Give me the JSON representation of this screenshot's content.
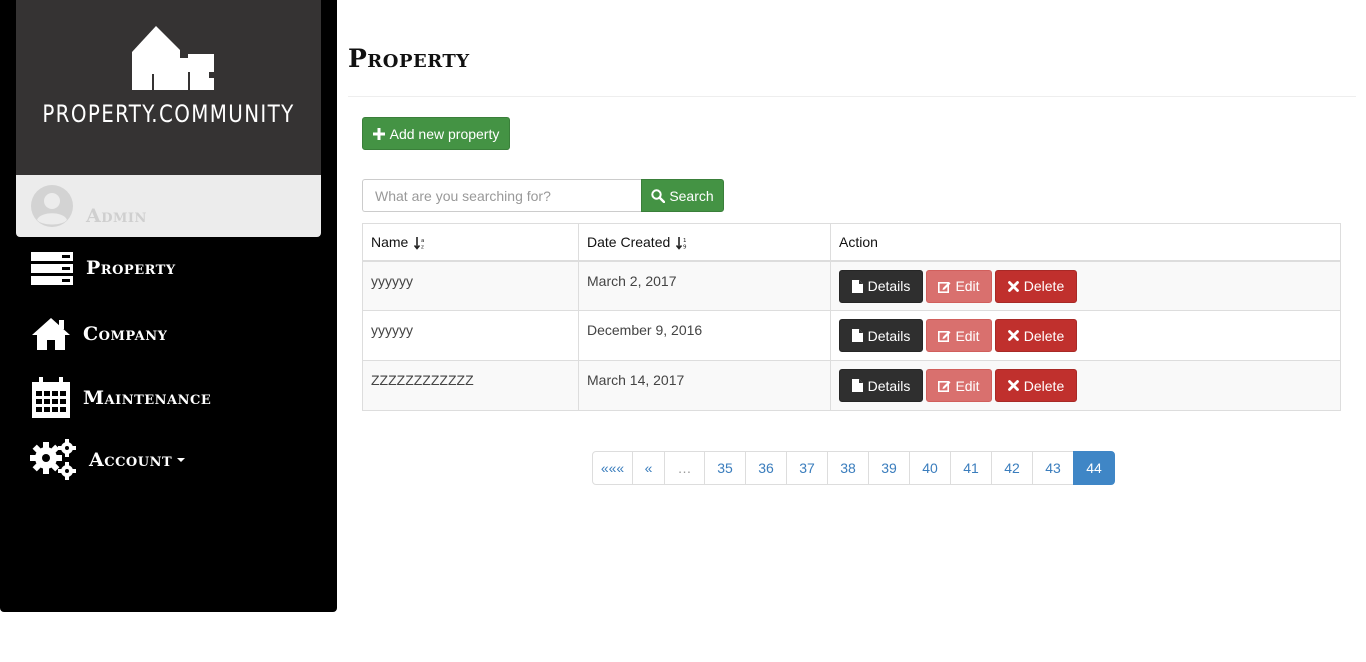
{
  "brand": {
    "name": "PROPERTY.COMMUNITY"
  },
  "user": {
    "name": "Admin"
  },
  "nav": [
    {
      "label": "Property",
      "icon": "server-icon"
    },
    {
      "label": "Company",
      "icon": "home-icon"
    },
    {
      "label": "Maintenance",
      "icon": "calendar-icon"
    },
    {
      "label": "Account",
      "icon": "gears-icon"
    }
  ],
  "page": {
    "title": "Property"
  },
  "actions": {
    "add_label": "Add new property"
  },
  "search": {
    "placeholder": "What are you searching for?",
    "button_label": "Search"
  },
  "table": {
    "columns": [
      "Name",
      "Date Created",
      "Action"
    ],
    "rows": [
      {
        "name": "yyyyyy",
        "date": "March 2, 2017"
      },
      {
        "name": "yyyyyy",
        "date": "December 9, 2016"
      },
      {
        "name": "ZZZZZZZZZZZZ",
        "date": "March 14, 2017"
      }
    ],
    "row_actions": {
      "details": "Details",
      "edit": "Edit",
      "delete": "Delete"
    }
  },
  "pagination": {
    "first": "«««",
    "prev": "«",
    "ellipsis": "…",
    "pages": [
      "35",
      "36",
      "37",
      "38",
      "39",
      "40",
      "41",
      "42",
      "43",
      "44"
    ],
    "active": "44"
  },
  "colors": {
    "sidebar": "#000000",
    "logo_bg": "#353333",
    "success": "#449344",
    "dark_button": "#2f2f2f",
    "edit_button": "#d9706e",
    "delete_button": "#c0302d",
    "link": "#3a7dbd",
    "active_page": "#3f86c6"
  }
}
